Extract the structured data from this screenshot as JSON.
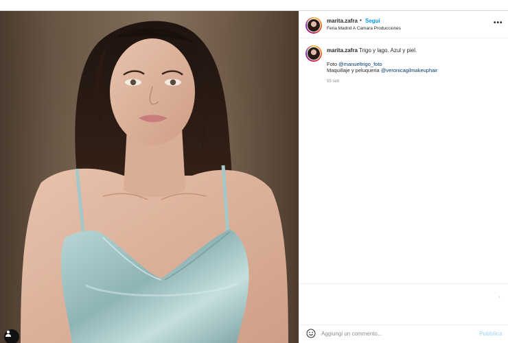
{
  "post": {
    "username": "marita.zafra",
    "separator": "•",
    "follow_label": "Segui",
    "location": "Feria Madrid A Camara Producciones",
    "more_icon": "more-horizontal-icon",
    "more_label": "•••"
  },
  "caption": {
    "username": "marita.zafra",
    "text": "Trigo y lago. Azul y piel.",
    "photo_prefix": "Foto ",
    "photo_mention": "@manueltrigo_foto",
    "makeup_prefix": "Maquillaje y peluqueria ",
    "makeup_mention": "@veronicagilmakeuphair",
    "time": "55 sett"
  },
  "comment": {
    "placeholder": "Aggiungi un commento...",
    "publish_label": "Pubblica",
    "emoji_icon": "smiley-icon"
  },
  "photo": {
    "tag_icon": "user-tag-icon"
  },
  "colors": {
    "accent": "#0095f6",
    "mention": "#00376b",
    "publish_disabled": "#b2dffc",
    "dress": "#9fc4c6"
  }
}
